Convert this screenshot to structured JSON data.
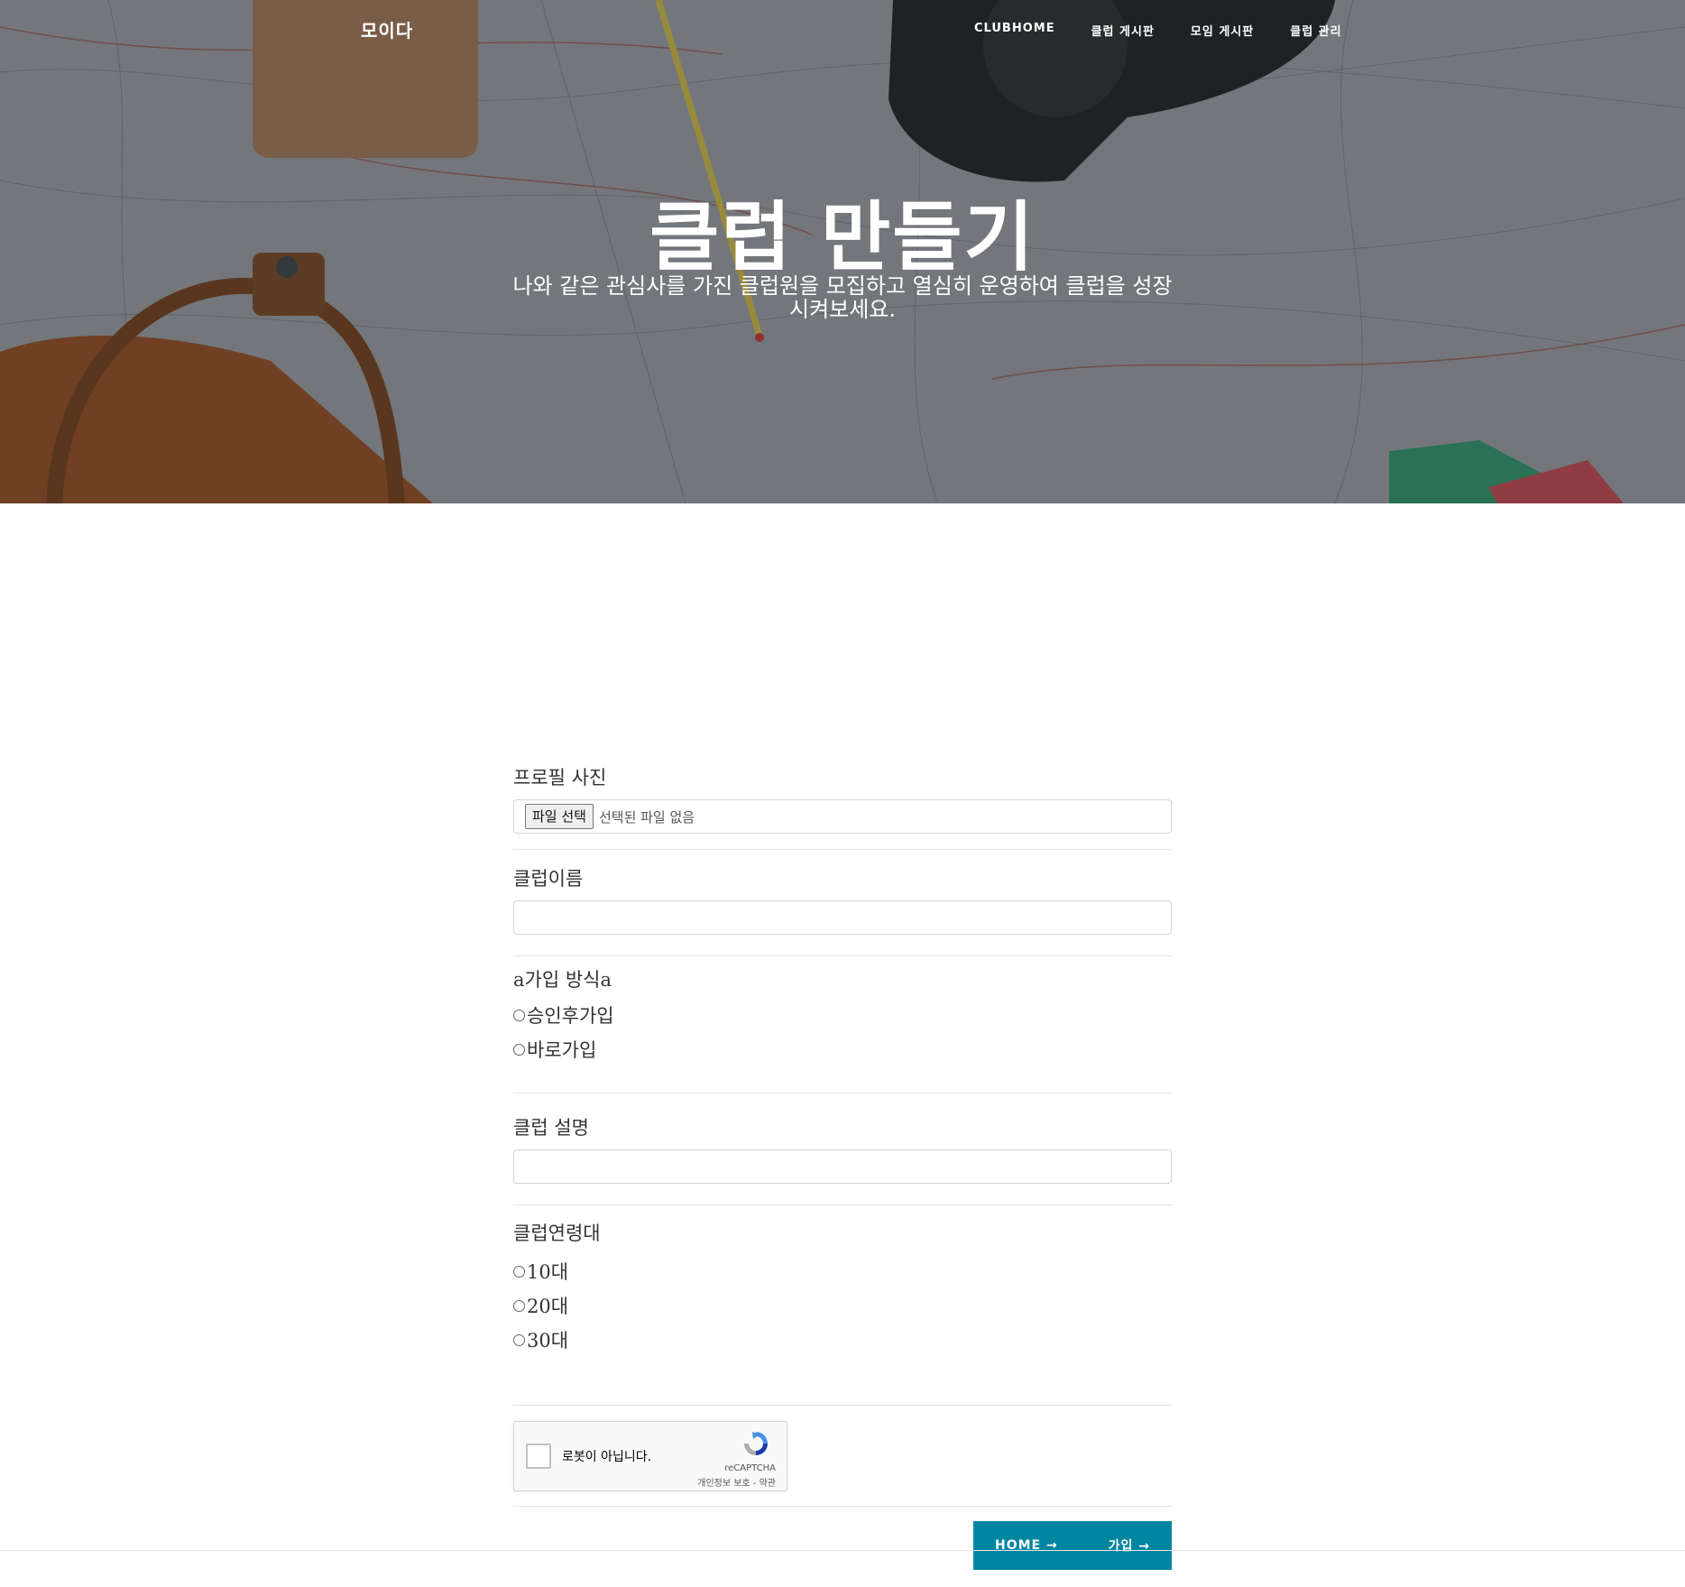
{
  "nav": {
    "brand": "모이다",
    "links": [
      "CLUBHOME",
      "클럽 게시판",
      "모임 게시판",
      "클럽 관리"
    ]
  },
  "hero": {
    "title": "클럽 만들기",
    "subtitle": "나와 같은 관심사를 가진 클럽원을 모집하고 열심히 운영하여 클럽을 성장시켜보세요."
  },
  "form": {
    "profile": {
      "label": "프로필 사진",
      "button": "파일 선택",
      "status": "선택된 파일 없음"
    },
    "club_name": {
      "label": "클럽이름",
      "value": ""
    },
    "join_method": {
      "label": "a가입 방식a",
      "options": [
        "승인후가입",
        "바로가입"
      ]
    },
    "description": {
      "label": "클럽 설명",
      "value": ""
    },
    "age_group": {
      "label": "클럽연령대",
      "options": [
        "10대",
        "20대",
        "30대"
      ]
    },
    "captcha": {
      "label": "로봇이 아닙니다.",
      "brand": "reCAPTCHA",
      "links": "개인정보 보호 - 약관"
    },
    "buttons": {
      "home": "HOME →",
      "join": "가입 →"
    }
  },
  "colors": {
    "button_bg": "#0085a1",
    "hero_overlay": "#212529"
  }
}
